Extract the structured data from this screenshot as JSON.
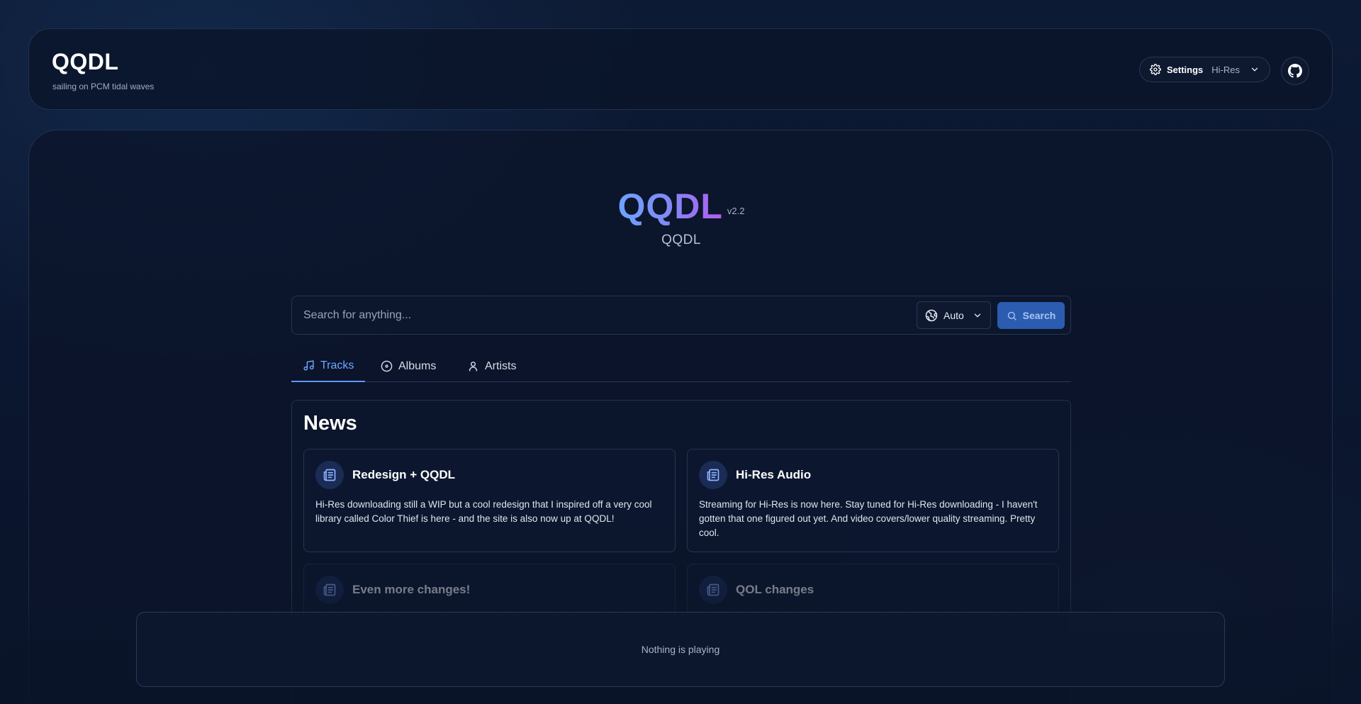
{
  "header": {
    "brand_title": "QQDL",
    "brand_subtitle": "sailing on PCM tidal waves",
    "settings": {
      "label": "Settings",
      "value": "Hi-Res",
      "icon": "gear-icon"
    },
    "github_icon": "github-icon"
  },
  "hero": {
    "title": "QQDL",
    "version": "v2.2",
    "subtitle": "QQDL"
  },
  "search": {
    "placeholder": "Search for anything...",
    "region_value": "Auto",
    "button_label": "Search"
  },
  "tabs": [
    {
      "label": "Tracks",
      "icon": "music-note-icon",
      "active": true
    },
    {
      "label": "Albums",
      "icon": "disc-icon",
      "active": false
    },
    {
      "label": "Artists",
      "icon": "user-icon",
      "active": false
    }
  ],
  "news": {
    "title": "News",
    "items": [
      {
        "title": "Redesign + QQDL",
        "body": "Hi-Res downloading still a WIP but a cool redesign that I inspired off a very cool library called Color Thief is here - and the site is also now up at QQDL!"
      },
      {
        "title": "Hi-Res Audio",
        "body": "Streaming for Hi-Res is now here. Stay tuned for Hi-Res downloading - I haven't gotten that one figured out yet. And video covers/lower quality streaming. Pretty cool."
      },
      {
        "title": "Even more changes!",
        "body": ""
      },
      {
        "title": "QOL changes",
        "body": ""
      }
    ]
  },
  "player": {
    "status": "Nothing is playing"
  },
  "colors": {
    "accent": "#5e97ff",
    "search_button": "#2b5cb0",
    "gradient_start": "#6fa2ff",
    "gradient_end": "#b25cf2"
  }
}
